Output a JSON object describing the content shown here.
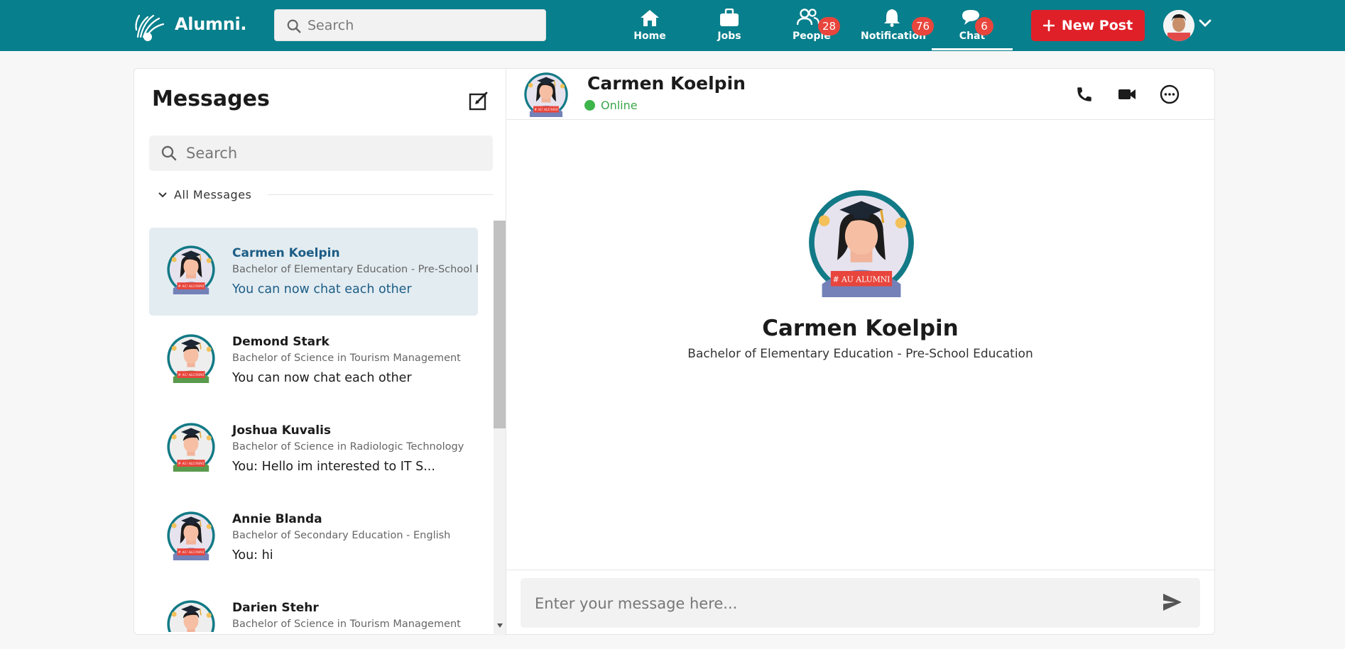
{
  "header": {
    "brand": "Alumni.",
    "search_placeholder": "Search",
    "nav": [
      {
        "label": "Home",
        "icon": "home-icon"
      },
      {
        "label": "Jobs",
        "icon": "briefcase-icon"
      },
      {
        "label": "People",
        "icon": "people-icon",
        "badge": "28"
      },
      {
        "label": "Notification",
        "icon": "bell-icon",
        "badge": "76"
      },
      {
        "label": "Chat",
        "icon": "chat-icon",
        "badge": "6"
      }
    ],
    "new_post_label": "New Post",
    "colors": {
      "bar": "#087f8c",
      "accent": "#e02028",
      "badge": "#e8453c"
    }
  },
  "sidebar": {
    "title": "Messages",
    "search_placeholder": "Search",
    "filter_label": "All Messages",
    "conversations": [
      {
        "name": "Carmen Koelpin",
        "course": "Bachelor of Elementary Education - Pre-School Education",
        "last": "You can now chat each other",
        "active": true
      },
      {
        "name": "Demond Stark",
        "course": "Bachelor of Science in Tourism Management",
        "last": "You can now chat each other"
      },
      {
        "name": "Joshua Kuvalis",
        "course": "Bachelor of Science in Radiologic Technology",
        "last": "You: Hello im interested to IT S..."
      },
      {
        "name": "Annie Blanda",
        "course": "Bachelor of Secondary Education - English",
        "last": "You: hi"
      },
      {
        "name": "Darien Stehr",
        "course": "Bachelor of Science in Tourism Management",
        "last": ""
      }
    ]
  },
  "chat": {
    "name": "Carmen Koelpin",
    "status": "Online",
    "profile_name": "Carmen Koelpin",
    "profile_course": "Bachelor of Elementary Education - Pre-School Education",
    "message_placeholder": "Enter your message here...",
    "avatar_banner": "# AU ALUMNI"
  }
}
